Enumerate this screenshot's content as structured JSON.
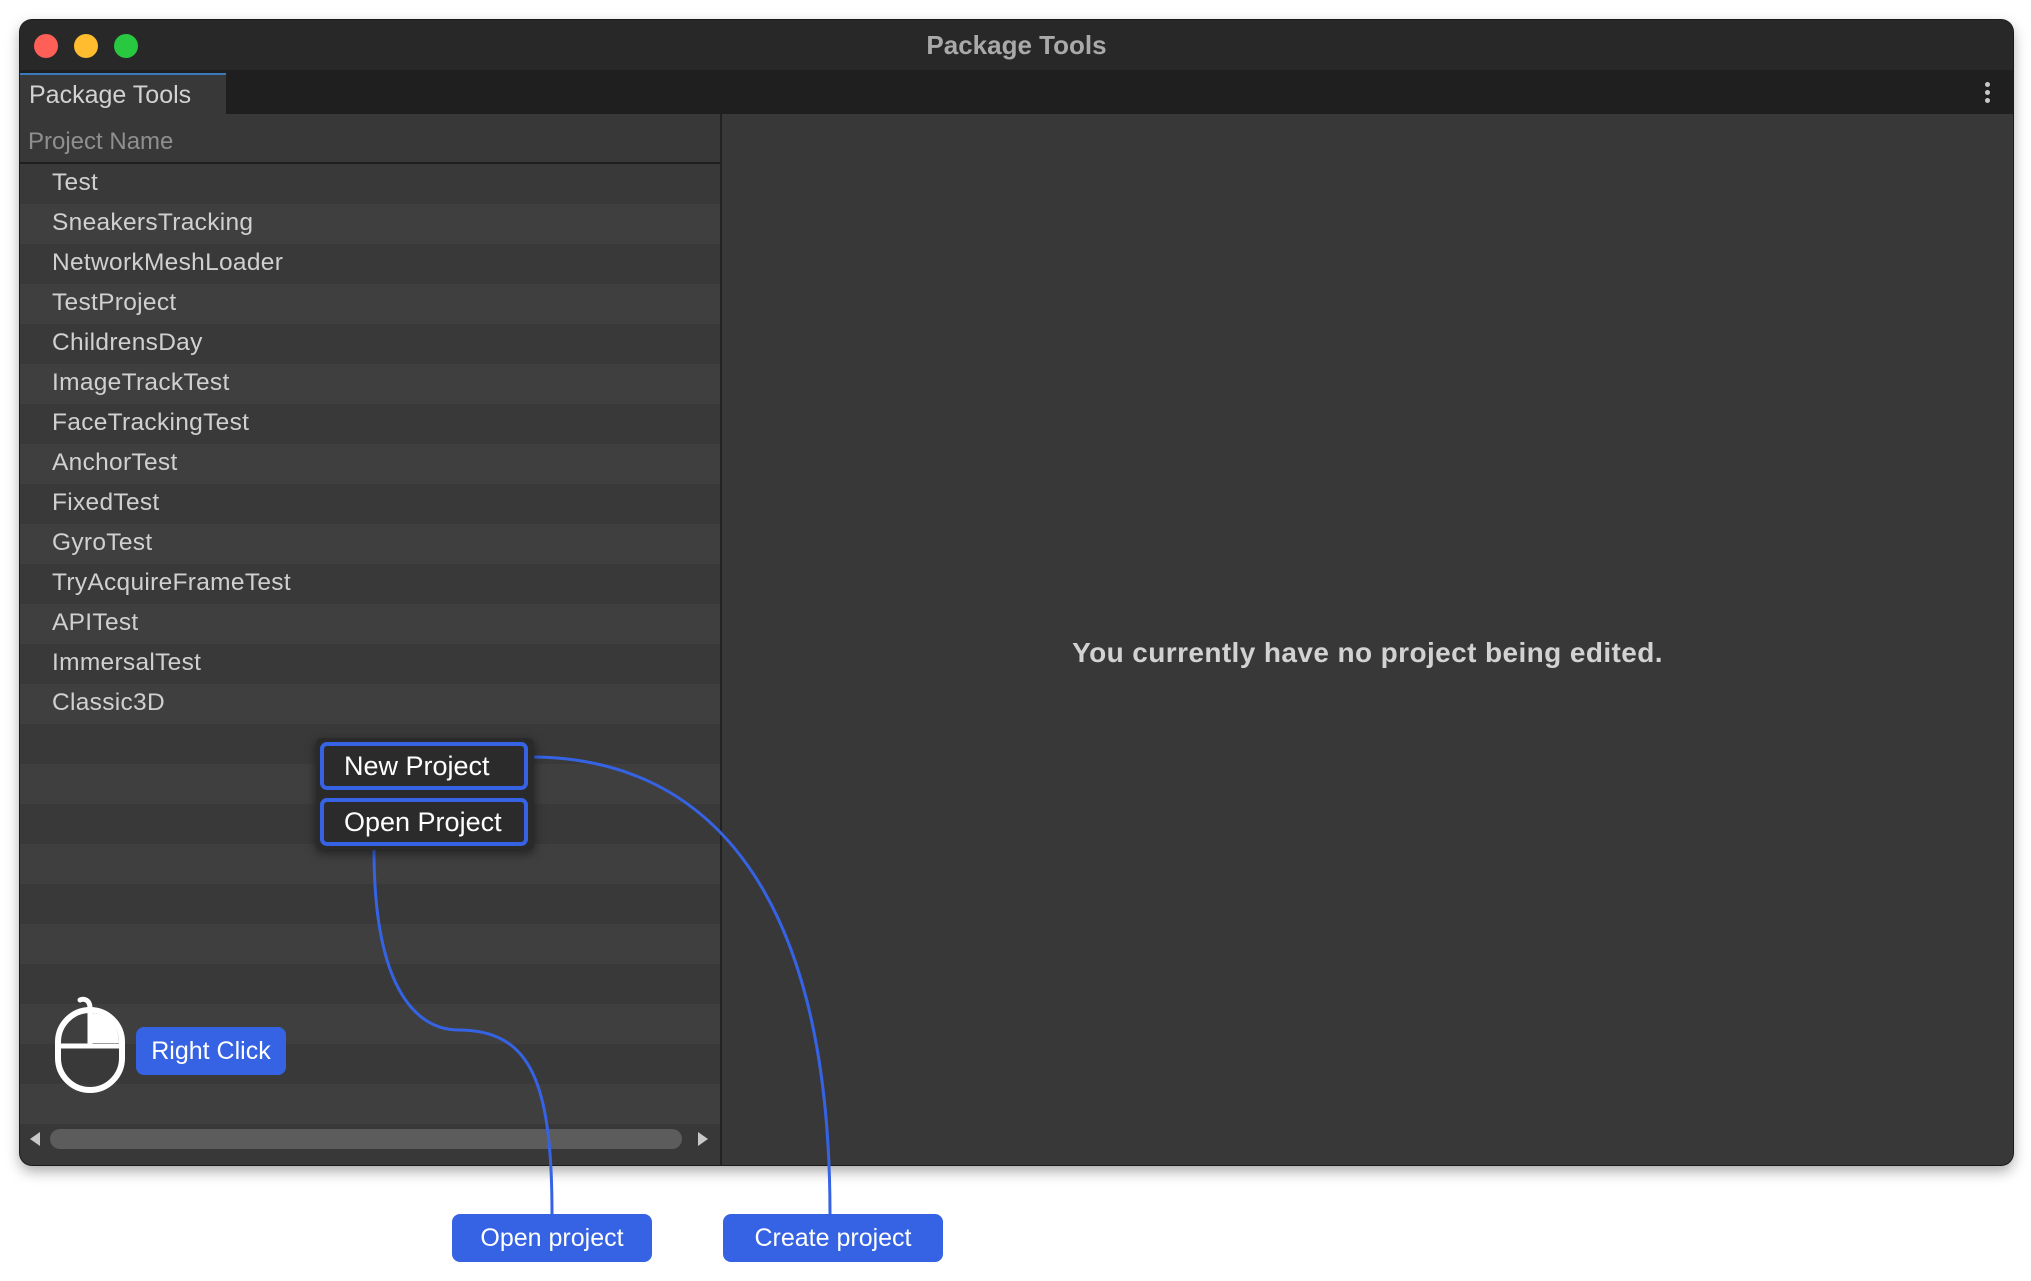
{
  "window": {
    "title": "Package Tools",
    "tab_label": "Package Tools"
  },
  "project_list": {
    "column_header": "Project Name",
    "items": [
      "Test",
      "SneakersTracking",
      "NetworkMeshLoader",
      "TestProject",
      "ChildrensDay",
      "ImageTrackTest",
      "FaceTrackingTest",
      "AnchorTest",
      "FixedTest",
      "GyroTest",
      "TryAcquireFrameTest",
      "APITest",
      "ImmersalTest",
      "Classic3D"
    ]
  },
  "main": {
    "empty_message": "You currently have no project being edited."
  },
  "context_menu": {
    "new_project": "New Project",
    "open_project": "Open Project"
  },
  "annotations": {
    "right_click": "Right Click",
    "open_project": "Open project",
    "create_project": "Create project",
    "mouse_icon": "mouse-icon"
  },
  "colors": {
    "accent": "#3563e4",
    "window_bg": "#383838",
    "titlebar_bg": "#282828"
  }
}
